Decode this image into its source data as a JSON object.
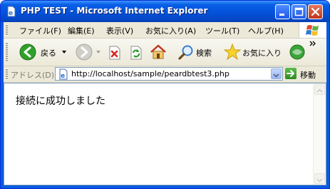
{
  "window": {
    "title": "PHP TEST - Microsoft Internet Explorer",
    "icons": {
      "app": "ie-page-icon",
      "minimize": "minimize-icon",
      "maximize": "maximize-icon",
      "close": "close-icon"
    }
  },
  "menubar": {
    "items": [
      {
        "label": "ファイル(F)"
      },
      {
        "label": "編集(E)"
      },
      {
        "label": "表示(V)"
      },
      {
        "label": "お気に入り(A)"
      },
      {
        "label": "ツール(T)"
      },
      {
        "label": "ヘルプ(H)"
      }
    ]
  },
  "toolbar": {
    "back_label": "戻る",
    "search_label": "検索",
    "favorites_label": "お気に入り"
  },
  "addressbar": {
    "label": "アドレス(D)",
    "url": "http://localhost/sample/peardbtest3.php",
    "go_label": "移動"
  },
  "page": {
    "message": "接続に成功しました"
  },
  "colors": {
    "titlebar": "#0554dd",
    "chrome": "#ece9d8",
    "back_button": "#2fa12a",
    "close_button": "#c2341a"
  }
}
